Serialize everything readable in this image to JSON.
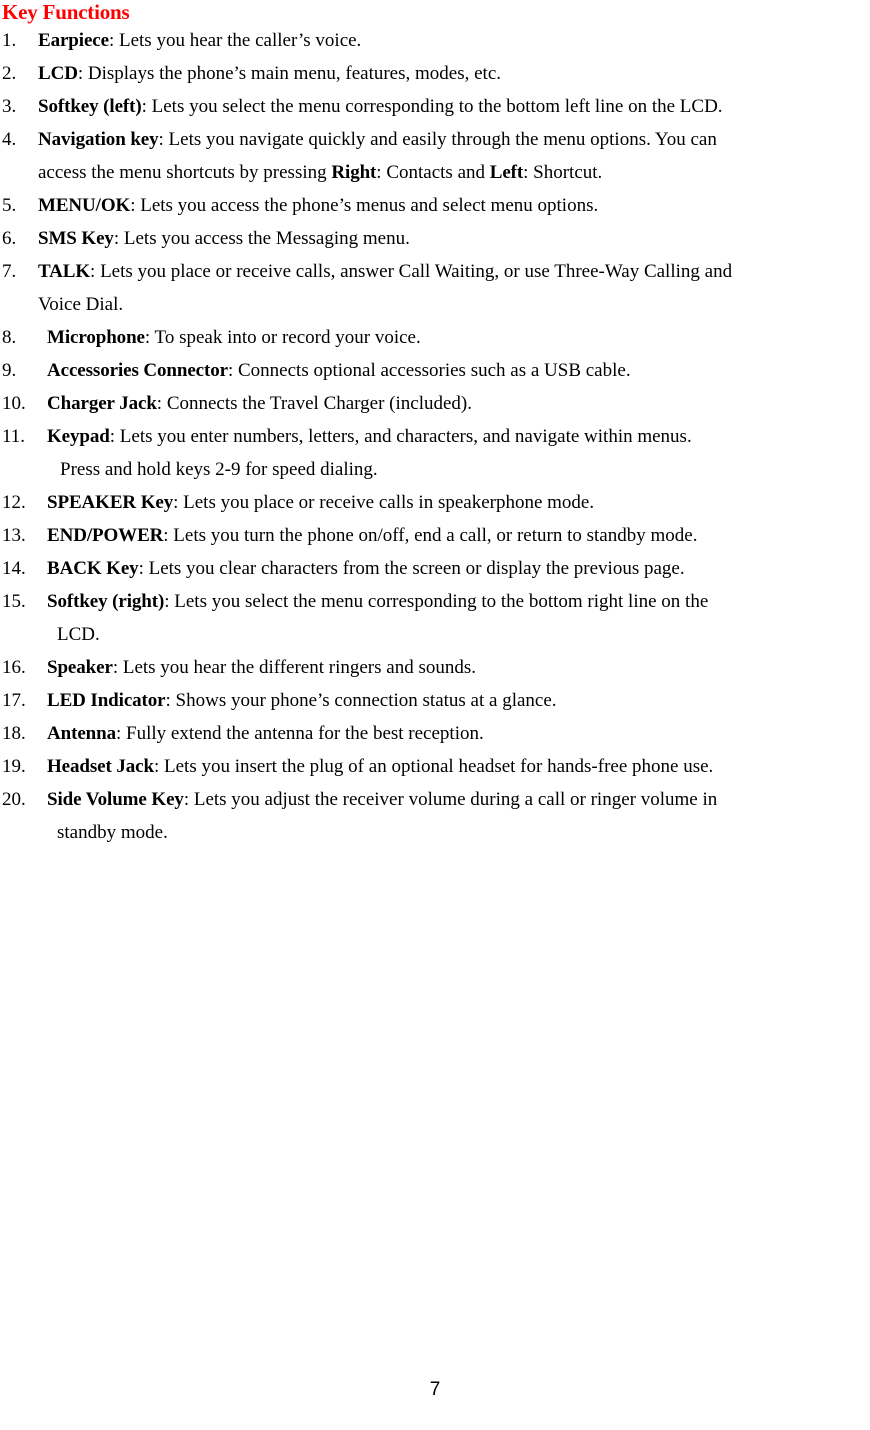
{
  "document": {
    "title": "Key Functions",
    "title_color": "#FF0000",
    "page_number": "7",
    "background_color": "#FFFFFF",
    "text_color": "#000000"
  },
  "items": [
    {
      "number": "1.",
      "label": "Earpiece",
      "description": ": Lets you hear the caller’s voice.",
      "continuations": []
    },
    {
      "number": "2.",
      "label": "LCD",
      "description": ": Displays the phone’s main menu, features, modes, etc.",
      "continuations": []
    },
    {
      "number": "3.",
      "label": "Softkey (left)",
      "description": ": Lets you select the menu corresponding to the bottom left line on the LCD.",
      "continuations": []
    },
    {
      "number": "4.",
      "label": "Navigation key",
      "description": ": Lets you navigate quickly and easily through the menu options. You can",
      "continuations": [
        {
          "pre": "access the menu shortcuts by pressing ",
          "bold1": "Right",
          "mid": ": Contacts and ",
          "bold2": "Left",
          "post": ": Shortcut."
        }
      ]
    },
    {
      "number": "5.",
      "label": "MENU/OK",
      "description": ": Lets you access the phone’s menus and select menu options.",
      "continuations": []
    },
    {
      "number": "6.",
      "label": "SMS Key",
      "description": ": Lets you access the Messaging menu.",
      "continuations": []
    },
    {
      "number": "7.",
      "label": "TALK",
      "description": ": Lets you place or receive calls, answer Call Waiting, or use Three-Way Calling and",
      "continuations": [
        {
          "pre": "Voice Dial."
        }
      ]
    },
    {
      "number": "8.",
      "label": "Microphone",
      "description": ": To speak into or record your voice.",
      "continuations": []
    },
    {
      "number": "9.",
      "label": "Accessories Connector",
      "description": ": Connects optional accessories such as a USB cable.",
      "continuations": []
    },
    {
      "number": "10.",
      "label": "Charger Jack",
      "description": ": Connects the Travel Charger (included).",
      "continuations": []
    },
    {
      "number": "11.",
      "label": "Keypad",
      "description": ": Lets you enter numbers, letters, and characters, and navigate within menus.",
      "continuations": [
        {
          "pre": "Press and hold keys 2-9 for speed dialing."
        }
      ]
    },
    {
      "number": "12.",
      "label": "SPEAKER Key",
      "description": ": Lets you place or receive calls in speakerphone mode.",
      "continuations": []
    },
    {
      "number": "13.",
      "label": "END/POWER",
      "description": ": Lets you turn the phone on/off, end a call, or return to standby mode.",
      "continuations": []
    },
    {
      "number": "14.",
      "label": "BACK Key",
      "description": ": Lets you clear characters from the screen or display the previous page.",
      "continuations": []
    },
    {
      "number": "15.",
      "label": "Softkey (right)",
      "description": ": Lets you select the menu corresponding to the bottom right line on the",
      "continuations": [
        {
          "pre": "LCD."
        }
      ]
    },
    {
      "number": "16.",
      "label": "Speaker",
      "description": ": Lets you hear the different ringers and sounds.",
      "continuations": []
    },
    {
      "number": "17.",
      "label": "LED Indicator",
      "description": ": Shows your phone’s connection status at a glance.",
      "continuations": []
    },
    {
      "number": "18.",
      "label": "Antenna",
      "description": ": Fully extend the antenna for the best reception.",
      "continuations": []
    },
    {
      "number": "19.",
      "label": "Headset Jack",
      "description": ": Lets you insert the plug of an optional headset for hands-free phone use.",
      "continuations": []
    },
    {
      "number": "20.",
      "label": "Side Volume Key",
      "description": ": Lets you adjust the receiver volume during a call or ringer volume in",
      "continuations": [
        {
          "pre": "standby mode."
        }
      ]
    }
  ]
}
